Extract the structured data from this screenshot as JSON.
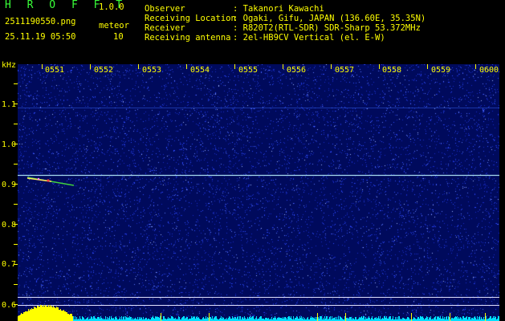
{
  "header": {
    "app_title": "H R O F F T",
    "version": "1.0.0",
    "filename": "2511190550.png",
    "timestamp": "25.11.19 05:50",
    "count_label": "meteor",
    "count_value": "10",
    "fields": [
      {
        "label": "Observer",
        "value": ": Takanori Kawachi"
      },
      {
        "label": "Receiving Location",
        "value": ": Ogaki, Gifu, JAPAN (136.60E, 35.35N)"
      },
      {
        "label": "Receiver",
        "value": ": R820T2(RTL-SDR) SDR-Sharp 53.372MHz"
      },
      {
        "label": "Receiving antenna",
        "value": ": 2el-HB9CV Vertical (el. E-W)"
      }
    ]
  },
  "axes": {
    "y_unit": "kHz",
    "x_ticks": [
      "0551",
      "0552",
      "0553",
      "0554",
      "0555",
      "0556",
      "0557",
      "0558",
      "0559",
      "0600"
    ],
    "y_ticks": [
      "1.1",
      "1.0",
      "0.9",
      "0.8",
      "0.7",
      "0.6"
    ]
  },
  "colors": {
    "text_yellow": "#ffff00",
    "title_green": "#39ff39",
    "background_blue": "#000a5c",
    "carrier_line": "#b8f0ff",
    "level_bar": "#00e0ff",
    "level_peak": "#ffff00"
  }
}
